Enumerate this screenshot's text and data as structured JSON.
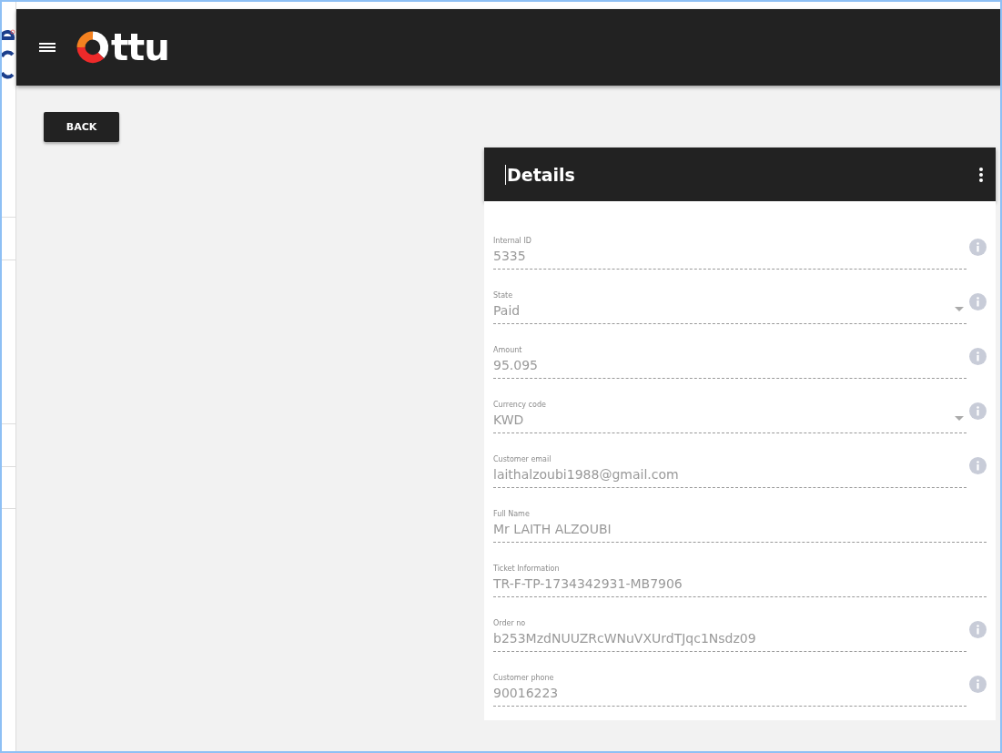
{
  "app_bar": {
    "logo": "ttu"
  },
  "back_button": "BACK",
  "details": {
    "title": "Details",
    "fields": [
      {
        "label": "Internal ID",
        "value": "5335",
        "kind": "text",
        "info": true
      },
      {
        "label": "State",
        "value": "Paid",
        "kind": "dropdown",
        "info": true
      },
      {
        "label": "Amount",
        "value": "95.095",
        "kind": "text",
        "info": true
      },
      {
        "label": "Currency code",
        "value": "KWD",
        "kind": "dropdown",
        "info": true
      },
      {
        "label": "Customer email",
        "value": "laithalzoubi1988@gmail.com",
        "kind": "text",
        "info": true
      },
      {
        "label": "Full Name",
        "value": "Mr LAITH ALZOUBI",
        "kind": "text",
        "info": false
      },
      {
        "label": "Ticket Information",
        "value": "TR-F-TP-1734342931-MB7906",
        "kind": "text",
        "info": false
      },
      {
        "label": "Order no",
        "value": "b253MzdNUUZRcWNuVXUrdTJqc1Nsdz09",
        "kind": "text",
        "info": true
      },
      {
        "label": "Customer phone",
        "value": "90016223",
        "kind": "text",
        "info": true
      }
    ]
  }
}
